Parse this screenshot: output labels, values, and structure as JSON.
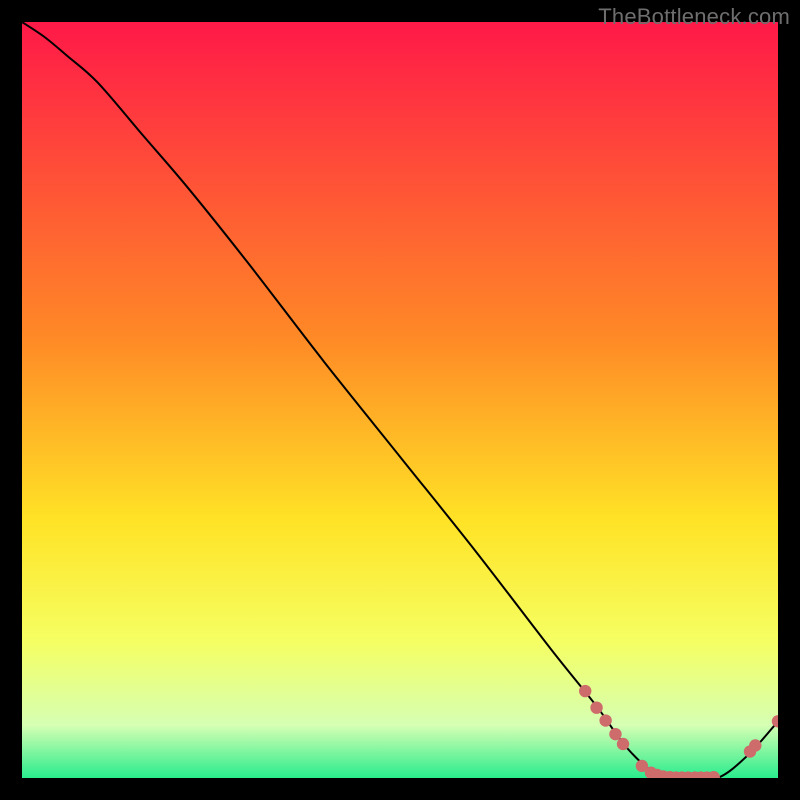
{
  "watermark": "TheBottleneck.com",
  "colors": {
    "black": "#000000",
    "curve": "#000000",
    "marker_fill": "#CE6B6B",
    "grad_top": "#FF1948",
    "grad_mid1": "#FF8A26",
    "grad_mid2": "#FFE326",
    "grad_mid3": "#F5FF63",
    "grad_low": "#D6FFB3",
    "grad_bottom": "#29EC8D"
  },
  "chart_data": {
    "type": "line",
    "title": "",
    "xlabel": "",
    "ylabel": "",
    "xlim": [
      0,
      100
    ],
    "ylim": [
      0,
      100
    ],
    "curve": {
      "x": [
        0,
        3,
        6,
        10,
        16,
        22,
        30,
        40,
        50,
        60,
        70,
        76,
        80,
        84,
        88,
        92,
        96,
        100
      ],
      "y": [
        100,
        98,
        95.5,
        92,
        85,
        78,
        68,
        55,
        42.5,
        30,
        17,
        9.5,
        4,
        0.5,
        0,
        0,
        3,
        7.5
      ]
    },
    "markers": [
      {
        "x": 74.5,
        "y": 11.5
      },
      {
        "x": 76.0,
        "y": 9.3
      },
      {
        "x": 77.2,
        "y": 7.6
      },
      {
        "x": 78.5,
        "y": 5.8
      },
      {
        "x": 79.5,
        "y": 4.5
      },
      {
        "x": 82.0,
        "y": 1.6
      },
      {
        "x": 83.2,
        "y": 0.7
      },
      {
        "x": 84.0,
        "y": 0.4
      },
      {
        "x": 84.8,
        "y": 0.2
      },
      {
        "x": 85.7,
        "y": 0.1
      },
      {
        "x": 86.5,
        "y": 0.05
      },
      {
        "x": 87.3,
        "y": 0.05
      },
      {
        "x": 88.1,
        "y": 0.05
      },
      {
        "x": 89.0,
        "y": 0.05
      },
      {
        "x": 89.8,
        "y": 0.05
      },
      {
        "x": 90.6,
        "y": 0.05
      },
      {
        "x": 91.5,
        "y": 0.1
      },
      {
        "x": 96.3,
        "y": 3.5
      },
      {
        "x": 97.0,
        "y": 4.3
      },
      {
        "x": 100.0,
        "y": 7.5
      }
    ]
  }
}
